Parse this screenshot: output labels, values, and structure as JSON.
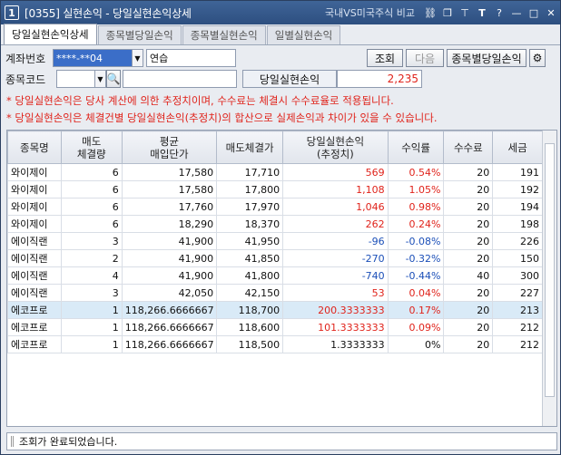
{
  "window": {
    "num": "1",
    "title": "[0355] 실현손익 - 당일실현손익상세",
    "right_label": "국내VS미국주식 비교",
    "icons": [
      "link-icon",
      "restore-icon",
      "pin-icon",
      "font-icon",
      "help-icon",
      "minimize-icon",
      "maximize-icon",
      "close-icon"
    ]
  },
  "tabs": [
    "당일실현손익상세",
    "종목별당일손익",
    "종목별실현손익",
    "일별실현손익"
  ],
  "form": {
    "account_label": "계좌번호",
    "account_value": "****-**04",
    "account_name": "연습",
    "query_btn": "조회",
    "next_btn": "다음",
    "stock_profit_btn": "종목별당일손익",
    "code_label": "종목코드",
    "code_value": "",
    "profit_label": "당일실현손익",
    "profit_value": "2,235"
  },
  "notes": [
    "* 당일실현손익은 당사 계산에 의한 추정치이며, 수수료는 체결시 수수료율로 적용됩니다.",
    "* 당일실현손익은 체결건별 당일실현손익(추정치)의 합산으로 실제손익과 차이가 있을 수 있습니다."
  ],
  "table": {
    "headers": [
      [
        "종목명"
      ],
      [
        "매도",
        "체결량"
      ],
      [
        "평균",
        "매입단가"
      ],
      [
        "매도체결가"
      ],
      [
        "당일실현손익",
        "(추정치)"
      ],
      [
        "수익률"
      ],
      [
        "수수료"
      ],
      [
        "세금"
      ]
    ],
    "rows": [
      {
        "name": "와이제이",
        "qty": "6",
        "avg": "17,580",
        "sell": "17,710",
        "pl": "569",
        "rate": "0.54%",
        "fee": "20",
        "tax": "191",
        "sign": "pos",
        "sel": false
      },
      {
        "name": "와이제이",
        "qty": "6",
        "avg": "17,580",
        "sell": "17,800",
        "pl": "1,108",
        "rate": "1.05%",
        "fee": "20",
        "tax": "192",
        "sign": "pos",
        "sel": false
      },
      {
        "name": "와이제이",
        "qty": "6",
        "avg": "17,760",
        "sell": "17,970",
        "pl": "1,046",
        "rate": "0.98%",
        "fee": "20",
        "tax": "194",
        "sign": "pos",
        "sel": false
      },
      {
        "name": "와이제이",
        "qty": "6",
        "avg": "18,290",
        "sell": "18,370",
        "pl": "262",
        "rate": "0.24%",
        "fee": "20",
        "tax": "198",
        "sign": "pos",
        "sel": false
      },
      {
        "name": "에이직랜",
        "qty": "3",
        "avg": "41,900",
        "sell": "41,950",
        "pl": "-96",
        "rate": "-0.08%",
        "fee": "20",
        "tax": "226",
        "sign": "neg",
        "sel": false
      },
      {
        "name": "에이직랜",
        "qty": "2",
        "avg": "41,900",
        "sell": "41,850",
        "pl": "-270",
        "rate": "-0.32%",
        "fee": "20",
        "tax": "150",
        "sign": "neg",
        "sel": false
      },
      {
        "name": "에이직랜",
        "qty": "4",
        "avg": "41,900",
        "sell": "41,800",
        "pl": "-740",
        "rate": "-0.44%",
        "fee": "40",
        "tax": "300",
        "sign": "neg",
        "sel": false
      },
      {
        "name": "에이직랜",
        "qty": "3",
        "avg": "42,050",
        "sell": "42,150",
        "pl": "53",
        "rate": "0.04%",
        "fee": "20",
        "tax": "227",
        "sign": "pos",
        "sel": false
      },
      {
        "name": "에코프로",
        "qty": "1",
        "avg": "118,266.6666667",
        "sell": "118,700",
        "pl": "200.3333333",
        "rate": "0.17%",
        "fee": "20",
        "tax": "213",
        "sign": "pos",
        "sel": true
      },
      {
        "name": "에코프로",
        "qty": "1",
        "avg": "118,266.6666667",
        "sell": "118,600",
        "pl": "101.3333333",
        "rate": "0.09%",
        "fee": "20",
        "tax": "212",
        "sign": "pos",
        "sel": false
      },
      {
        "name": "에코프로",
        "qty": "1",
        "avg": "118,266.6666667",
        "sell": "118,500",
        "pl": "1.3333333",
        "rate": "0%",
        "fee": "20",
        "tax": "212",
        "sign": "zero",
        "sel": false
      }
    ]
  },
  "status": "조회가 완료되었습니다.",
  "colors": {
    "positive": "#e0231b",
    "negative": "#1b4fb8",
    "selected_row": "#d9eaf7"
  }
}
